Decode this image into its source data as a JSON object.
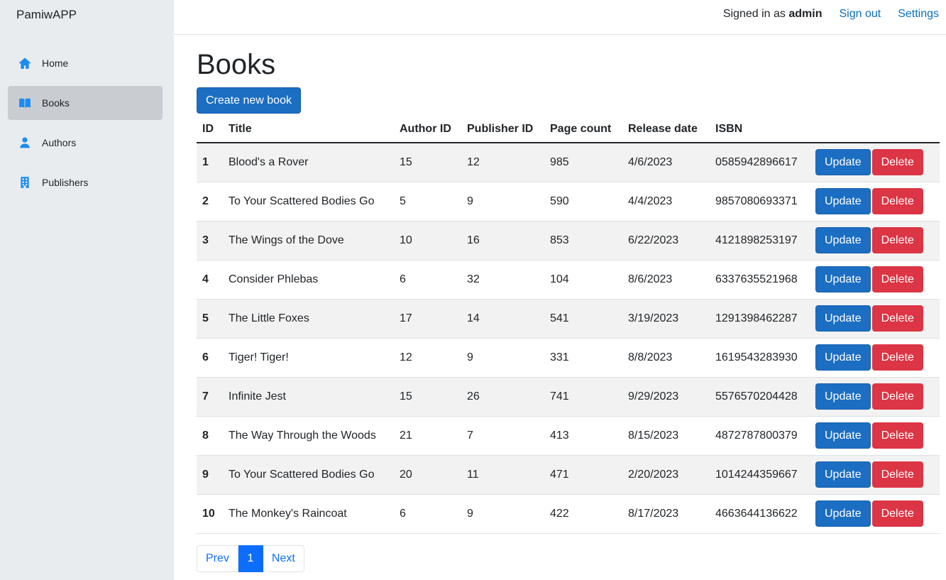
{
  "app": {
    "brand": "PamiwAPP"
  },
  "sidebar": {
    "items": [
      {
        "label": "Home",
        "icon": "home-icon",
        "active": false
      },
      {
        "label": "Books",
        "icon": "book-icon",
        "active": true
      },
      {
        "label": "Authors",
        "icon": "person-icon",
        "active": false
      },
      {
        "label": "Publishers",
        "icon": "building-icon",
        "active": false
      }
    ]
  },
  "header": {
    "signed_in_prefix": "Signed in as ",
    "username": "admin",
    "sign_out": "Sign out",
    "settings": "Settings"
  },
  "page": {
    "title": "Books",
    "create_button": "Create new book"
  },
  "table": {
    "columns": [
      "ID",
      "Title",
      "Author ID",
      "Publisher ID",
      "Page count",
      "Release date",
      "ISBN"
    ],
    "update_label": "Update",
    "delete_label": "Delete",
    "rows": [
      [
        "1",
        "Blood's a Rover",
        "15",
        "12",
        "985",
        "4/6/2023",
        "0585942896617"
      ],
      [
        "2",
        "To Your Scattered Bodies Go",
        "5",
        "9",
        "590",
        "4/4/2023",
        "9857080693371"
      ],
      [
        "3",
        "The Wings of the Dove",
        "10",
        "16",
        "853",
        "6/22/2023",
        "4121898253197"
      ],
      [
        "4",
        "Consider Phlebas",
        "6",
        "32",
        "104",
        "8/6/2023",
        "6337635521968"
      ],
      [
        "5",
        "The Little Foxes",
        "17",
        "14",
        "541",
        "3/19/2023",
        "1291398462287"
      ],
      [
        "6",
        "Tiger! Tiger!",
        "12",
        "9",
        "331",
        "8/8/2023",
        "1619543283930"
      ],
      [
        "7",
        "Infinite Jest",
        "15",
        "26",
        "741",
        "9/29/2023",
        "5576570204428"
      ],
      [
        "8",
        "The Way Through the Woods",
        "21",
        "7",
        "413",
        "8/15/2023",
        "4872787800379"
      ],
      [
        "9",
        "To Your Scattered Bodies Go",
        "20",
        "11",
        "471",
        "2/20/2023",
        "1014244359667"
      ],
      [
        "10",
        "The Monkey's Raincoat",
        "6",
        "9",
        "422",
        "8/17/2023",
        "4663644136622"
      ]
    ]
  },
  "pagination": {
    "prev": "Prev",
    "current": "1",
    "next": "Next"
  },
  "colors": {
    "primary": "#1b6ec2",
    "danger": "#dc3545",
    "link": "#0a6ebd",
    "sidebar_bg": "#e9ecef",
    "icon": "#1b8cf0"
  }
}
